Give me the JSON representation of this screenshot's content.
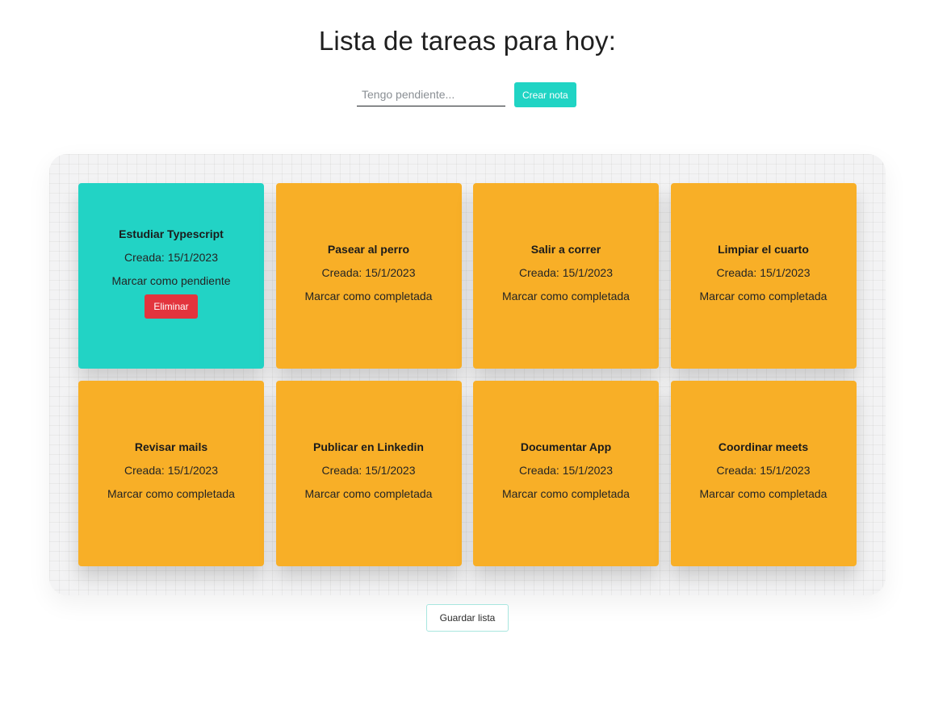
{
  "header": {
    "title": "Lista de tareas para hoy:"
  },
  "form": {
    "placeholder": "Tengo pendiente...",
    "value": "",
    "create_label": "Crear nota"
  },
  "tasks": [
    {
      "title": "Estudiar Typescript",
      "date": "Creada: 15/1/2023",
      "toggle": "Marcar como pendiente",
      "completed": true,
      "delete_label": "Eliminar"
    },
    {
      "title": "Pasear al perro",
      "date": "Creada: 15/1/2023",
      "toggle": "Marcar como completada",
      "completed": false
    },
    {
      "title": "Salir a correr",
      "date": "Creada: 15/1/2023",
      "toggle": "Marcar como completada",
      "completed": false
    },
    {
      "title": "Limpiar el cuarto",
      "date": "Creada: 15/1/2023",
      "toggle": "Marcar como completada",
      "completed": false
    },
    {
      "title": "Revisar mails",
      "date": "Creada: 15/1/2023",
      "toggle": "Marcar como completada",
      "completed": false
    },
    {
      "title": "Publicar en Linkedin",
      "date": "Creada: 15/1/2023",
      "toggle": "Marcar como completada",
      "completed": false
    },
    {
      "title": "Documentar App",
      "date": "Creada: 15/1/2023",
      "toggle": "Marcar como completada",
      "completed": false
    },
    {
      "title": "Coordinar meets",
      "date": "Creada: 15/1/2023",
      "toggle": "Marcar como completada",
      "completed": false
    }
  ],
  "footer": {
    "save_label": "Guardar lista"
  },
  "colors": {
    "accent": "#20d4c4",
    "completed_card": "#22d3c5",
    "pending_card": "#f8af27",
    "danger": "#e3343d"
  }
}
